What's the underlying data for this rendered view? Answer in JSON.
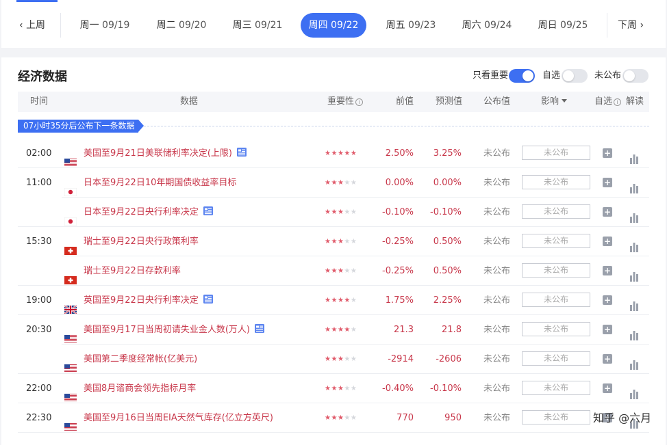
{
  "week_nav": {
    "prev_label": "上周",
    "next_label": "下周",
    "days": [
      {
        "weekday": "周一",
        "date": "09/19",
        "active": false
      },
      {
        "weekday": "周二",
        "date": "09/20",
        "active": false
      },
      {
        "weekday": "周三",
        "date": "09/21",
        "active": false
      },
      {
        "weekday": "周四",
        "date": "09/22",
        "active": true
      },
      {
        "weekday": "周五",
        "date": "09/23",
        "active": false
      },
      {
        "weekday": "周六",
        "date": "09/24",
        "active": false
      },
      {
        "weekday": "周日",
        "date": "09/25",
        "active": false
      }
    ]
  },
  "panel": {
    "title": "经济数据",
    "toggles": [
      {
        "label": "只看重要",
        "on": true
      },
      {
        "label": "自选",
        "on": false
      },
      {
        "label": "未公布",
        "on": false
      }
    ]
  },
  "columns": {
    "time": "时间",
    "data": "数据",
    "importance": "重要性",
    "previous": "前值",
    "forecast": "预测值",
    "published": "公布值",
    "impact": "影响",
    "watchlist": "自选",
    "interpretation": "解读"
  },
  "countdown": "07小时35分后公布下一条数据",
  "colors": {
    "accent": "#3d6ff2",
    "data_red": "#c8374a",
    "star_on": "#e05a6a",
    "star_off": "#d5d7dc"
  },
  "rows": [
    {
      "time": "02:00",
      "flag": "us-flag",
      "name": "美国至9月21日美联储利率决定(上限)",
      "has_doc": true,
      "stars": 5,
      "previous": "2.50%",
      "forecast": "3.25%",
      "published": "未公布",
      "impact": "未公布"
    },
    {
      "time": "11:00",
      "flag": "jp-flag",
      "name": "日本至9月22日10年期国债收益率目标",
      "has_doc": false,
      "stars": 3,
      "previous": "0.00%",
      "forecast": "0.00%",
      "published": "未公布",
      "impact": "未公布"
    },
    {
      "time": "",
      "flag": "jp-flag",
      "name": "日本至9月22日央行利率决定",
      "has_doc": true,
      "stars": 3,
      "previous": "-0.10%",
      "forecast": "-0.10%",
      "published": "未公布",
      "impact": "未公布"
    },
    {
      "time": "15:30",
      "flag": "ch-flag",
      "name": "瑞士至9月22日央行政策利率",
      "has_doc": false,
      "stars": 3,
      "previous": "-0.25%",
      "forecast": "0.50%",
      "published": "未公布",
      "impact": "未公布"
    },
    {
      "time": "",
      "flag": "ch-flag",
      "name": "瑞士至9月22日存款利率",
      "has_doc": false,
      "stars": 3,
      "previous": "-0.25%",
      "forecast": "0.50%",
      "published": "未公布",
      "impact": "未公布"
    },
    {
      "time": "19:00",
      "flag": "uk-flag",
      "name": "英国至9月22日央行利率决定",
      "has_doc": true,
      "stars": 4,
      "previous": "1.75%",
      "forecast": "2.25%",
      "published": "未公布",
      "impact": "未公布"
    },
    {
      "time": "20:30",
      "flag": "us-flag",
      "name": "美国至9月17日当周初请失业金人数(万人)",
      "has_doc": true,
      "stars": 4,
      "previous": "21.3",
      "forecast": "21.8",
      "published": "未公布",
      "impact": "未公布"
    },
    {
      "time": "",
      "flag": "us-flag",
      "name": "美国第二季度经常帐(亿美元)",
      "has_doc": false,
      "stars": 3,
      "previous": "-2914",
      "forecast": "-2606",
      "published": "未公布",
      "impact": "未公布"
    },
    {
      "time": "22:00",
      "flag": "us-flag",
      "name": "美国8月谘商会领先指标月率",
      "has_doc": false,
      "stars": 3,
      "previous": "-0.40%",
      "forecast": "-0.10%",
      "published": "未公布",
      "impact": "未公布"
    },
    {
      "time": "22:30",
      "flag": "us-flag",
      "name": "美国至9月16日当周EIA天然气库存(亿立方英尺)",
      "has_doc": false,
      "stars": 3,
      "previous": "770",
      "forecast": "950",
      "published": "未公布",
      "impact": "未公布"
    }
  ],
  "watermark": "知乎 @六月"
}
